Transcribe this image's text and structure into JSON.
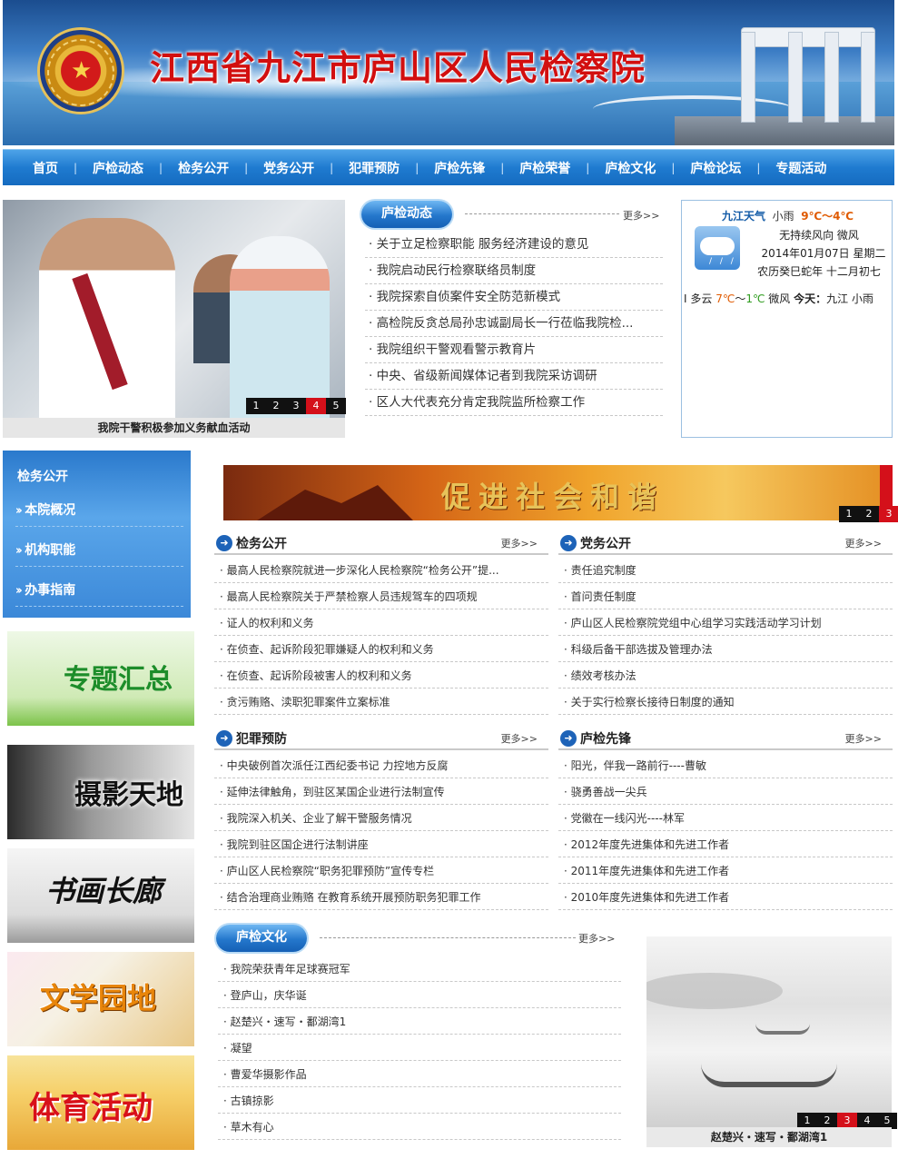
{
  "site": {
    "title": "江西省九江市庐山区人民检察院"
  },
  "nav": [
    "首页",
    "庐检动态",
    "检务公开",
    "党务公开",
    "犯罪预防",
    "庐检先锋",
    "庐检荣誉",
    "庐检文化",
    "庐检论坛",
    "专题活动"
  ],
  "slideshow1": {
    "caption": "我院干警积极参加义务献血活动",
    "pages": [
      "1",
      "2",
      "3",
      "4",
      "5"
    ],
    "active": "4"
  },
  "news": {
    "tab": "庐检动态",
    "more": "更多>>",
    "items": [
      "关于立足检察职能 服务经济建设的意见",
      "我院启动民行检察联络员制度",
      "我院探索自侦案件安全防范新模式",
      "高检院反贪总局孙忠诚副局长一行莅临我院检...",
      "我院组织干警观看警示教育片",
      "中央、省级新闻媒体记者到我院采访调研",
      "区人大代表充分肯定我院监所检察工作"
    ]
  },
  "weather": {
    "city": "九江天气",
    "cond": "小雨",
    "temp": "9℃～4℃",
    "wind": "无持续风向 微风",
    "date": "2014年01月07日 星期二",
    "lunar": "农历癸巳蛇年 十二月初七",
    "tomorrow_prefix": "Ⅰ 多云",
    "tomorrow_hi": "7℃",
    "tomorrow_sep": "～",
    "tomorrow_lo": "1℃",
    "tomorrow_wind": "微风",
    "today_label": "今天：",
    "today_text": "九江 小雨"
  },
  "sidebar": {
    "header": "检务公开",
    "items": [
      "本院概况",
      "机构职能",
      "办事指南"
    ],
    "promos": [
      "专题汇总",
      "摄影天地",
      "书画长廊",
      "文学园地",
      "体育活动"
    ]
  },
  "banner2": {
    "text": "促进社会和谐",
    "pages": [
      "1",
      "2",
      "3"
    ],
    "active": "3"
  },
  "jiancha": {
    "title": "检务公开",
    "more": "更多>>",
    "items": [
      "最高人民检察院就进一步深化人民检察院“检务公开”提...",
      "最高人民检察院关于严禁检察人员违规驾车的四项规",
      "证人的权利和义务",
      "在侦查、起诉阶段犯罪嫌疑人的权利和义务",
      "在侦查、起诉阶段被害人的权利和义务",
      "贪污贿赂、渎职犯罪案件立案标准"
    ]
  },
  "dangwu": {
    "title": "党务公开",
    "more": "更多>>",
    "items": [
      "责任追究制度",
      "首问责任制度",
      "庐山区人民检察院党组中心组学习实践活动学习计划",
      "科级后备干部选拔及管理办法",
      "绩效考核办法",
      "关于实行检察长接待日制度的通知"
    ]
  },
  "fanzui": {
    "title": "犯罪预防",
    "more": "更多>>",
    "items": [
      "中央破例首次派任江西纪委书记 力控地方反腐",
      "延伸法律触角，到驻区某国企业进行法制宣传",
      "我院深入机关、企业了解干警服务情况",
      "我院到驻区国企进行法制讲座",
      "庐山区人民检察院“职务犯罪预防”宣传专栏",
      "结合治理商业贿赂 在教育系统开展预防职务犯罪工作"
    ]
  },
  "xianfeng": {
    "title": "庐检先锋",
    "more": "更多>>",
    "items": [
      "阳光，伴我一路前行----曹敏",
      "骁勇善战一尖兵",
      "党徽在一线闪光----林军",
      "2012年度先进集体和先进工作者",
      "2011年度先进集体和先进工作者",
      "2010年度先进集体和先进工作者"
    ]
  },
  "wenhua": {
    "tab": "庐检文化",
    "more": "更多>>",
    "items": [
      "我院荣获青年足球赛冠军",
      "登庐山，庆华诞",
      "赵楚兴・速写・鄱湖湾1",
      "凝望",
      "曹爱华摄影作品",
      "古镇掠影",
      "草木有心"
    ]
  },
  "slideshow2": {
    "caption": "赵楚兴・速写・鄱湖湾1",
    "pages": [
      "1",
      "2",
      "3",
      "4",
      "5"
    ],
    "active": "3"
  }
}
